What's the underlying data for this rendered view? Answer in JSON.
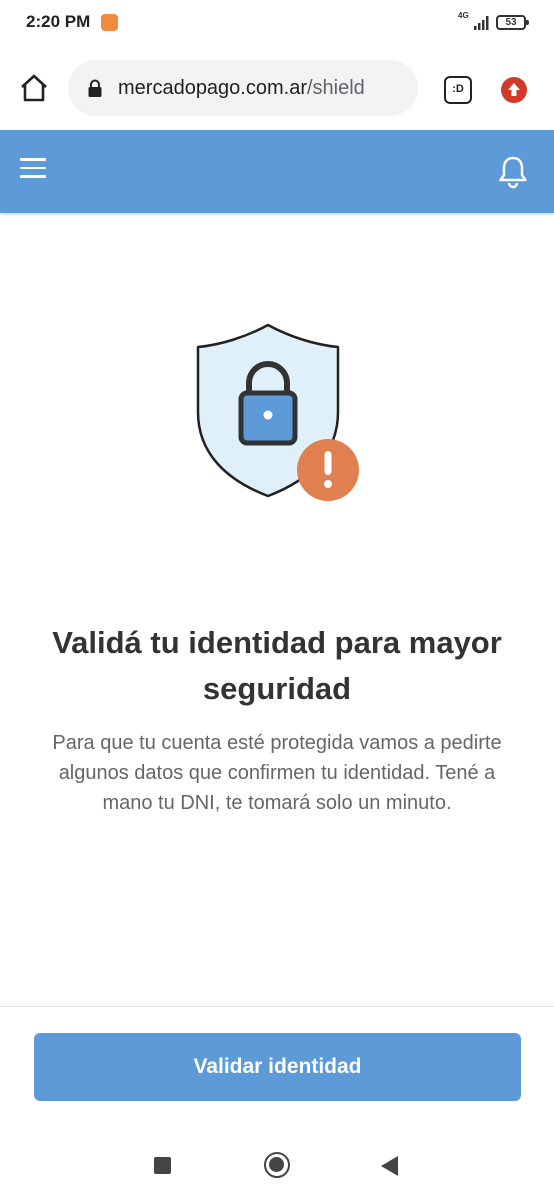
{
  "status_bar": {
    "time": "2:20 PM",
    "network": "4G",
    "battery": "53"
  },
  "browser": {
    "url_domain": "mercadopago.com.ar",
    "url_path": "/shield",
    "tab_label": ":D"
  },
  "icons": {
    "home": "home-icon",
    "lock": "lock-icon",
    "menu": "hamburger-menu-icon",
    "bell": "bell-icon",
    "shield": "shield-lock-warning-icon"
  },
  "colors": {
    "brand_blue": "#5c9ad8",
    "warning_orange": "#e07f4f",
    "shield_fill": "#dff0fa"
  },
  "main": {
    "title": "Validá tu identidad para mayor seguridad",
    "description": "Para que tu cuenta esté protegida vamos a pedirte algunos datos que confirmen tu identidad. Tené a mano tu DNI, te tomará solo un minuto."
  },
  "footer": {
    "validate_button": "Validar identidad"
  }
}
